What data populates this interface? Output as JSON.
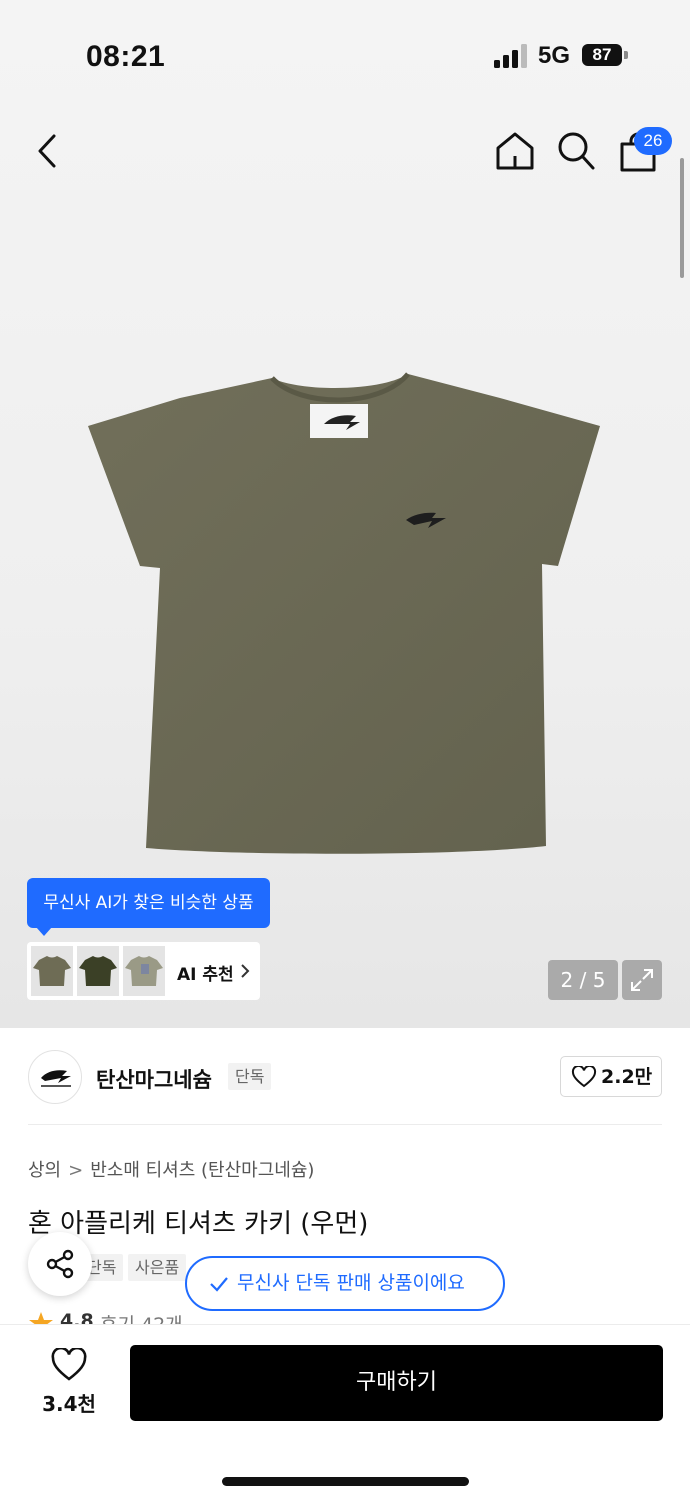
{
  "status_bar": {
    "time": "08:21",
    "network": "5G",
    "battery": "87"
  },
  "header": {
    "cart_count": "26"
  },
  "gallery": {
    "page_indicator": "2 / 5",
    "shirt_color": "#6b6a55"
  },
  "ai_recommend": {
    "tooltip": "무신사 AI가 찾은 비슷한 상품",
    "label": "AI 추천"
  },
  "brand": {
    "name": "탄산마그네슘",
    "badge": "단독",
    "likes": "2.2만"
  },
  "breadcrumb": [
    "상의",
    "반소매 티셔츠 (탄산마그네슘)"
  ],
  "product": {
    "title": "혼 아플리케 티셔츠 카키 (우먼)",
    "tags": [
      "단독",
      "사은품"
    ],
    "exclusive_notice": "무신사 단독 판매 상품이에요",
    "rating": "4.8",
    "reviews": "후기 42개"
  },
  "bottom_bar": {
    "wish_count": "3.4천",
    "buy_label": "구매하기"
  },
  "colors": {
    "accent": "#1f6bff",
    "buy_button": "#000000"
  }
}
